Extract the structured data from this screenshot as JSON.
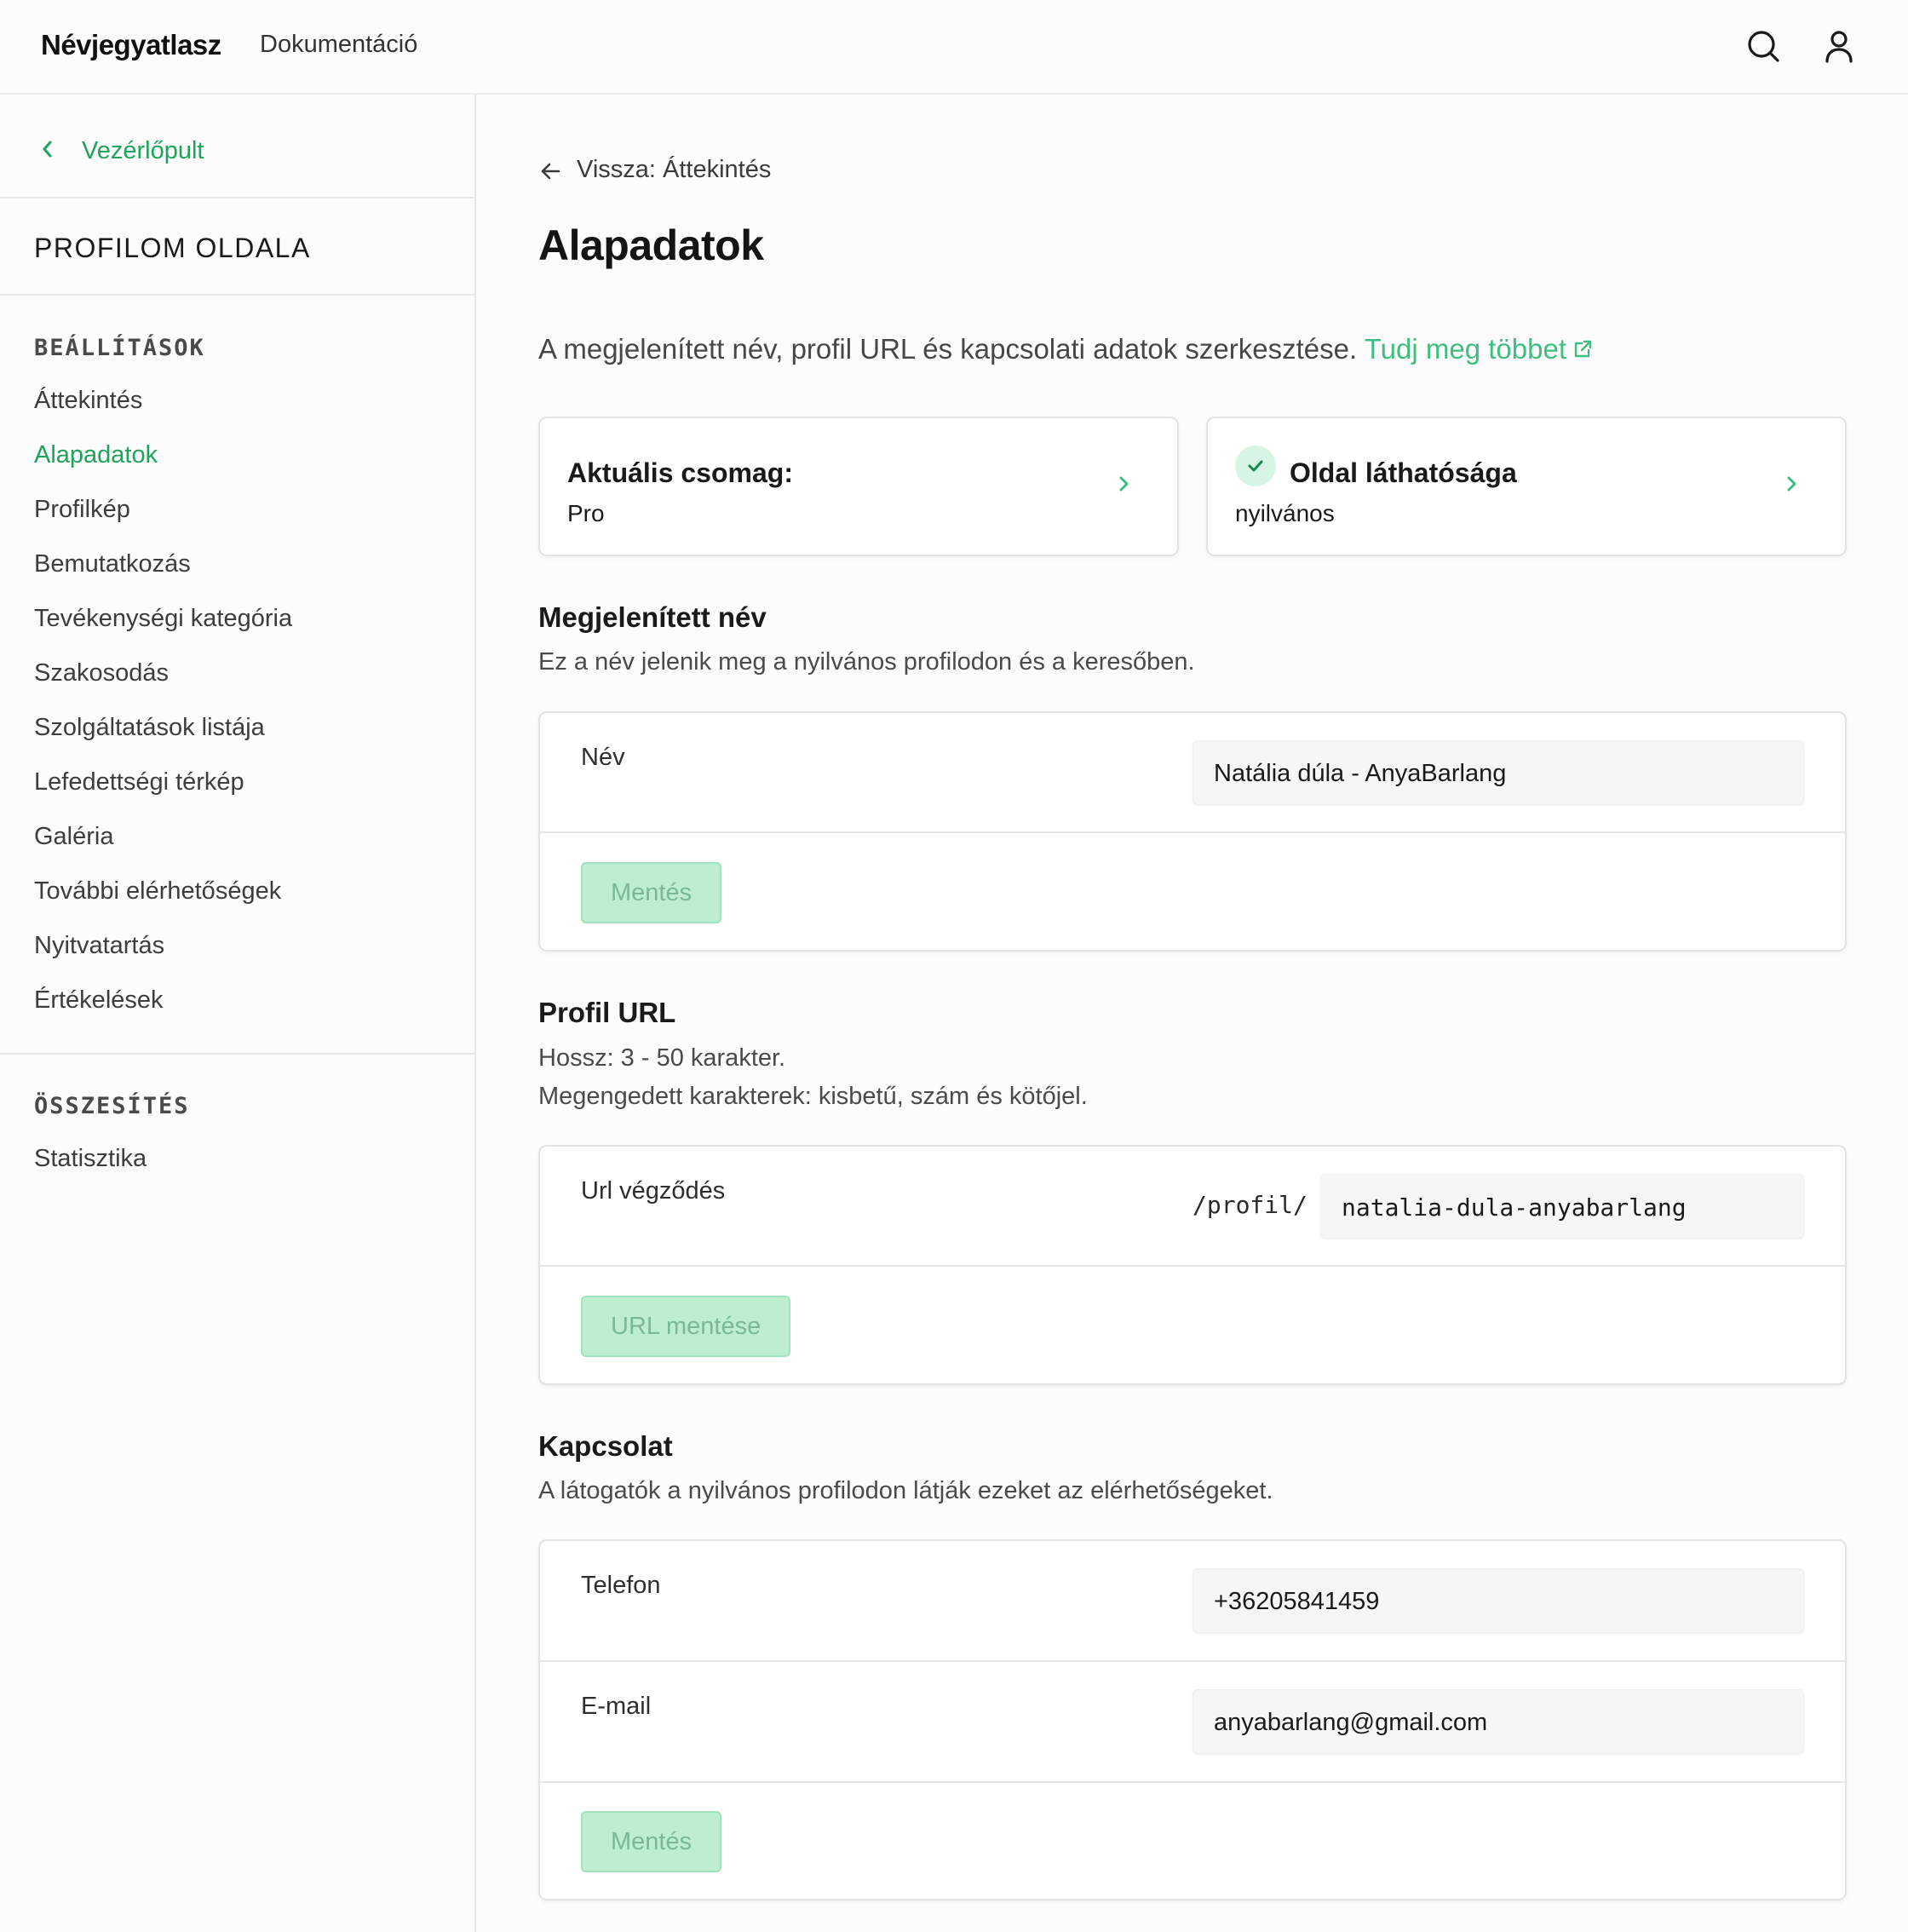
{
  "app": {
    "brand": "Névjegyatlasz",
    "docs_link": "Dokumentáció"
  },
  "topbar_icons": [
    "search-icon",
    "user-icon"
  ],
  "sidebar": {
    "back_label": "Vezérlőpult",
    "title": "PROFILOM OLDALA",
    "sections": [
      {
        "heading": "BEÁLLÍTÁSOK",
        "items": [
          "Áttekintés",
          "Alapadatok",
          "Profilkép",
          "Bemutatkozás",
          "Tevékenységi kategória",
          "Szakosodás",
          "Szolgáltatások listája",
          "Lefedettségi térkép",
          "Galéria",
          "További elérhetőségek",
          "Nyitvatartás",
          "Értékelések"
        ]
      },
      {
        "heading": "ÖSSZESÍTÉS",
        "items": [
          "Statisztika"
        ]
      }
    ],
    "active_item": "Alapadatok"
  },
  "main": {
    "back_link": "Vissza: Áttekintés",
    "title": "Alapadatok",
    "description": "A megjelenített név, profil URL és kapcsolati adatok szerkesztése.",
    "learn_more": "Tudj meg többet",
    "plan_card": {
      "title": "Aktuális csomag:",
      "value": "Pro"
    },
    "visibility_card": {
      "title": "Oldal láthatósága",
      "value": "nyilvános"
    },
    "display_name": {
      "title": "Megjelenített név",
      "description": "Ez a név jelenik meg a nyilvános profilodon és a keresőben.",
      "field_label": "Név",
      "field_value": "Natália dúla - AnyaBarlang",
      "button": "Mentés"
    },
    "profile_url": {
      "title": "Profil URL",
      "description_1": "Hossz: 3 - 50 karakter.",
      "description_2": "Megengedett karakterek: kisbetű, szám és kötőjel.",
      "field_label": "Url végződés",
      "prefix": "/profil/",
      "field_value": "natalia-dula-anyabarlang",
      "button": "URL mentése"
    },
    "contact": {
      "title": "Kapcsolat",
      "description": "A látogatók a nyilvános profilodon látják ezeket az elérhetőségeket.",
      "phone_label": "Telefon",
      "phone_value": "+36205841459",
      "email_label": "E-mail",
      "email_value": "anyabarlang@gmail.com",
      "button": "Mentés"
    }
  },
  "colors": {
    "accent": "#1fa25c",
    "link": "#3fbf7f",
    "button_bg": "#bdeed2",
    "button_text": "#7ab89a"
  }
}
